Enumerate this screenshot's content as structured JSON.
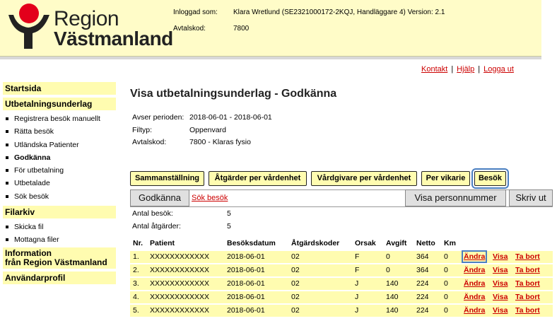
{
  "header": {
    "logo_line1": "Region",
    "logo_line2": "Västmanland",
    "logged_in_label": "Inloggad som:",
    "logged_in_value": "Klara Wretlund (SE2321000172-2KQJ, Handläggare 4) Version: 2.1",
    "contract_label": "Avtalskod:",
    "contract_value": "7800"
  },
  "toplinks": {
    "contact": "Kontakt",
    "help": "Hjälp",
    "logout": "Logga ut",
    "separator": "|"
  },
  "sidebar": {
    "startsida": "Startsida",
    "utbetalningsunderlag": "Utbetalningsunderlag",
    "items": [
      "Registrera besök manuellt",
      "Rätta besök",
      "Utländska Patienter",
      "Godkänna",
      "För utbetalning",
      "Utbetalade",
      "Sök besök"
    ],
    "filarkiv": "Filarkiv",
    "filarkiv_items": [
      "Skicka fil",
      "Mottagna filer"
    ],
    "information_line1": "Information",
    "information_line2": "från Region Västmanland",
    "anvandarprofil": "Användarprofil"
  },
  "main": {
    "title": "Visa utbetalningsunderlag - Godkänna",
    "period_label": "Avser perioden:",
    "period_value": "2018-06-01 - 2018-06-01",
    "filetype_label": "Filtyp:",
    "filetype_value": "Oppenvard",
    "contract_label": "Avtalskod:",
    "contract_value": "7800 - Klaras fysio"
  },
  "tabs": [
    "Sammanställning",
    "Åtgärder per vårdenhet",
    "Vårdgivare per vårdenhet",
    "Per vikarie",
    "Besök"
  ],
  "buttons": {
    "approve": "Godkänna",
    "search_visit": "Sök besök",
    "show_pnr": "Visa personnummer",
    "print": "Skriv ut"
  },
  "stats": {
    "visits_label": "Antal besök:",
    "visits_value": "5",
    "actions_label": "Antal åtgärder:",
    "actions_value": "5"
  },
  "table": {
    "headers": [
      "Nr.",
      "Patient",
      "Besöksdatum",
      "Åtgärdskoder",
      "Orsak",
      "Avgift",
      "Netto",
      "Km"
    ],
    "link_edit": "Ändra",
    "link_view": "Visa",
    "link_delete": "Ta bort",
    "rows": [
      [
        "1.",
        "XXXXXXXXXXXX",
        "2018-06-01",
        "02",
        "F",
        "0",
        "364",
        "0"
      ],
      [
        "2.",
        "XXXXXXXXXXXX",
        "2018-06-01",
        "02",
        "F",
        "0",
        "364",
        "0"
      ],
      [
        "3.",
        "XXXXXXXXXXXX",
        "2018-06-01",
        "02",
        "J",
        "140",
        "224",
        "0"
      ],
      [
        "4.",
        "XXXXXXXXXXXX",
        "2018-06-01",
        "02",
        "J",
        "140",
        "224",
        "0"
      ],
      [
        "5.",
        "XXXXXXXXXXXX",
        "2018-06-01",
        "02",
        "J",
        "140",
        "224",
        "0"
      ]
    ]
  }
}
